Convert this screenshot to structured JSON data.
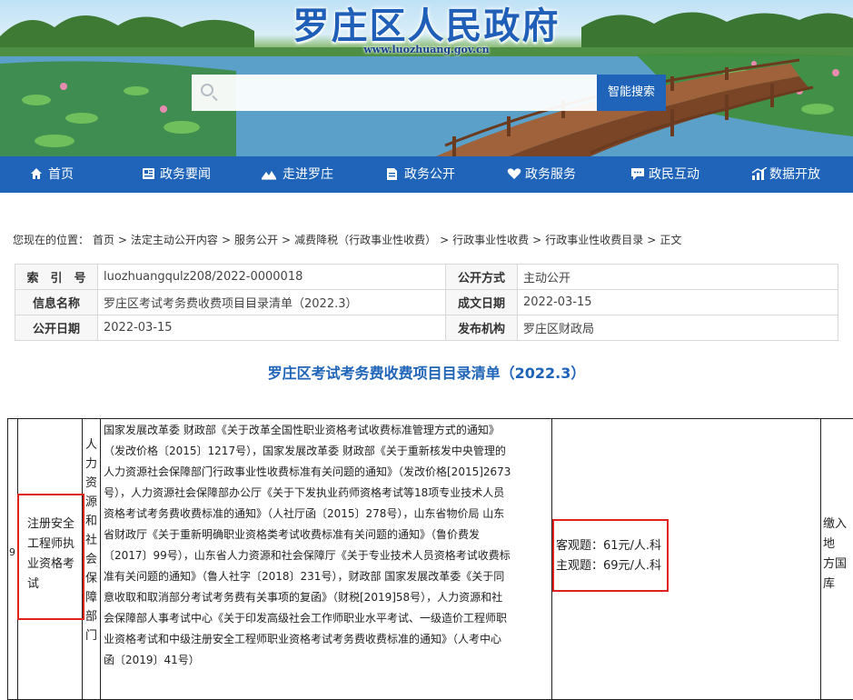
{
  "site": {
    "title": "罗庄区人民政府",
    "url": "www.luozhuang.gov.cn"
  },
  "search": {
    "placeholder": "",
    "button_label": "智能搜索"
  },
  "nav": [
    {
      "label": "首页",
      "icon": "home-icon"
    },
    {
      "label": "政务要闻",
      "icon": "newspaper-icon"
    },
    {
      "label": "走进罗庄",
      "icon": "landscape-icon"
    },
    {
      "label": "政务公开",
      "icon": "document-icon"
    },
    {
      "label": "政务服务",
      "icon": "heart-icon"
    },
    {
      "label": "政民互动",
      "icon": "chat-icon"
    },
    {
      "label": "数据开放",
      "icon": "chart-icon"
    }
  ],
  "breadcrumb": {
    "prefix": "您现在的位置：",
    "items": [
      "首页",
      "法定主动公开内容",
      "服务公开",
      "减费降税（行政事业性收费）",
      "行政事业性收费",
      "行政事业性收费目录",
      "正文"
    ]
  },
  "info": {
    "index_label": "索　引　号",
    "index_value": "luozhuangqulz208/2022-0000018",
    "method_label": "公开方式",
    "method_value": "主动公开",
    "name_label": "信息名称",
    "name_value": "罗庄区考试考务费收费项目目录清单（2022.3）",
    "date_label": "成文日期",
    "date_value": "2022-03-15",
    "publish_label": "公开日期",
    "publish_value": "2022-03-15",
    "org_label": "发布机构",
    "org_value": "罗庄区财政局"
  },
  "document_title": "罗庄区考试考务费收费项目目录清单（2022.3）",
  "row": {
    "number": "9",
    "item": [
      "注册安全",
      "工程师执",
      "业资格考",
      "试"
    ],
    "department": [
      "人",
      "力",
      "资",
      "源",
      "和",
      "社",
      "会",
      "保",
      "障",
      "部",
      "门"
    ],
    "basis": [
      "国家发展改革委 财政部《关于改革全国性职业资格考试收费标准管理方式的通知》",
      "（发改价格〔2015〕1217号），国家发展改革委 财政部《关于重新核发中央管理的",
      "人力资源社会保障部门行政事业性收费标准有关问题的通知》（发改价格[2015]2673",
      "号），人力资源社会保障部办公厅《关于下发执业药师资格考试等18项专业技术人员",
      "资格考试考务费收费标准的通知》（人社厅函〔2015〕278号），山东省物价局 山东",
      "省财政厅《关于重新明确职业资格类考试收费标准有关问题的通知》（鲁价费发",
      "〔2017〕99号），山东省人力资源和社会保障厅《关于专业技术人员资格考试收费标",
      "准有关问题的通知》（鲁人社字〔2018〕231号），财政部 国家发展改革委《关于同",
      "意收取和取消部分考试考务费有关事项的复函》（财税[2019]58号），人力资源和社",
      "会保障部人事考试中心《关于印发高级社会工作师职业水平考试、一级造价工程师职",
      "业资格考试和中级注册安全工程师职业资格考试考务费收费标准的通知》（人考中心",
      "函〔2019〕41号）"
    ],
    "fees": [
      "客观题：61元/人.科",
      "主观题：69元/人.科"
    ],
    "remark": [
      "缴入",
      "地",
      "方国",
      "库"
    ]
  },
  "colors": {
    "primary": "#1f64b8",
    "highlight": "#e0241b"
  }
}
